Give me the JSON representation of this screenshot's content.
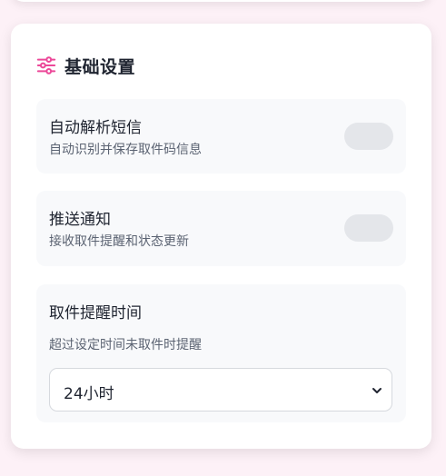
{
  "section": {
    "title": "基础设置",
    "icon": "sliders-icon",
    "accent_color": "#ec4899"
  },
  "settings": [
    {
      "label": "自动解析短信",
      "description": "自动识别并保存取件码信息",
      "enabled": false
    },
    {
      "label": "推送通知",
      "description": "接收取件提醒和状态更新",
      "enabled": false
    },
    {
      "label": "取件提醒时间",
      "description": "超过设定时间未取件时提醒",
      "selected": "24小时"
    }
  ]
}
